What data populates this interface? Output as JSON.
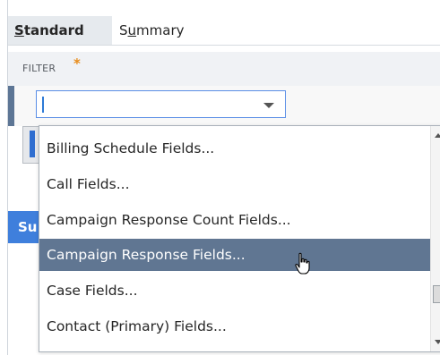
{
  "tabs": [
    {
      "label_underlined": "S",
      "label_rest": "tandard",
      "selected": true
    },
    {
      "label_pre": "S",
      "label_underlined": "u",
      "label_rest": "mmary",
      "selected": false
    }
  ],
  "filter": {
    "label": "FILTER",
    "required_mark": "*",
    "value": ""
  },
  "sub_button_stub": "Su",
  "dropdown": {
    "options": [
      "Billing Schedule Fields...",
      "Call Fields...",
      "Campaign Response Count Fields...",
      "Campaign Response Fields...",
      "Case Fields...",
      "Contact (Primary) Fields..."
    ],
    "highlighted_option": "Campaign Response Fields..."
  },
  "colors": {
    "highlight": "#607692",
    "accent_blue": "#3f7fdc",
    "required_star": "#e88c1a"
  },
  "icons": [
    "chevron-down-icon",
    "scroll-up-icon",
    "scroll-down-icon",
    "hand-cursor-icon"
  ]
}
